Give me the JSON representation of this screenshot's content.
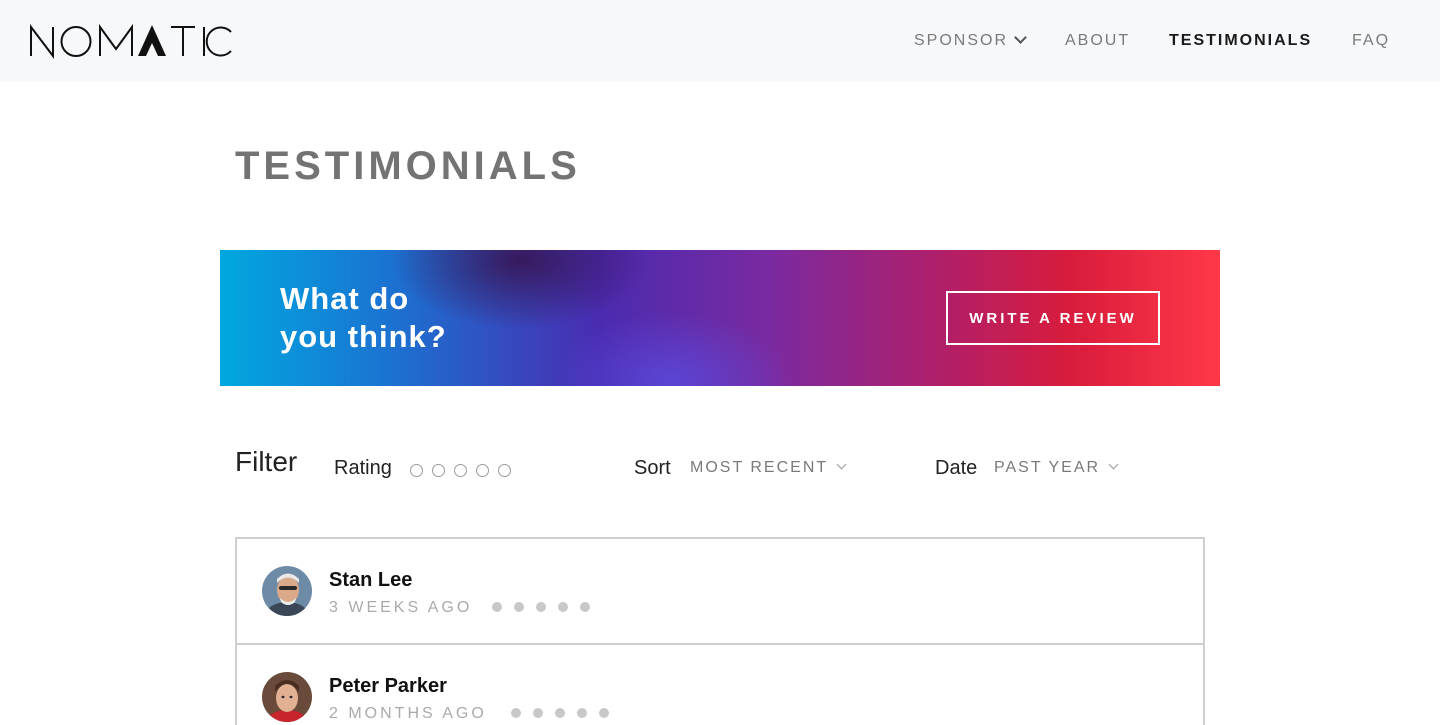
{
  "header": {
    "logo_text": "NOMATIC",
    "nav": [
      {
        "label": "SPONSOR",
        "has_dropdown": true,
        "active": false
      },
      {
        "label": "ABOUT",
        "active": false
      },
      {
        "label": "TESTIMONIALS",
        "active": true
      },
      {
        "label": "FAQ",
        "active": false
      }
    ]
  },
  "page_title": "TESTIMONIALS",
  "banner": {
    "text_line1": "What do",
    "text_line2": "you think?",
    "button_label": "WRITE A REVIEW"
  },
  "filter": {
    "label": "Filter",
    "rating_label": "Rating",
    "rating_dots": 5,
    "sort_label": "Sort",
    "sort_value": "MOST RECENT",
    "date_label": "Date",
    "date_value": "PAST YEAR"
  },
  "reviews": [
    {
      "name": "Stan Lee",
      "date": "3 WEEKS AGO",
      "rating_dots": 5,
      "avatar_icon": "stan-lee-avatar"
    },
    {
      "name": "Peter Parker",
      "date": "2 MONTHS AGO",
      "rating_dots": 5,
      "avatar_icon": "peter-parker-avatar"
    }
  ],
  "colors": {
    "header_bg": "#f7f8fa",
    "banner_start": "#00a8e0",
    "banner_mid": "#4a2bb0",
    "banner_end": "#ff3848",
    "nav_active": "#1a1a1a",
    "nav_inactive": "#7a7a7a"
  }
}
